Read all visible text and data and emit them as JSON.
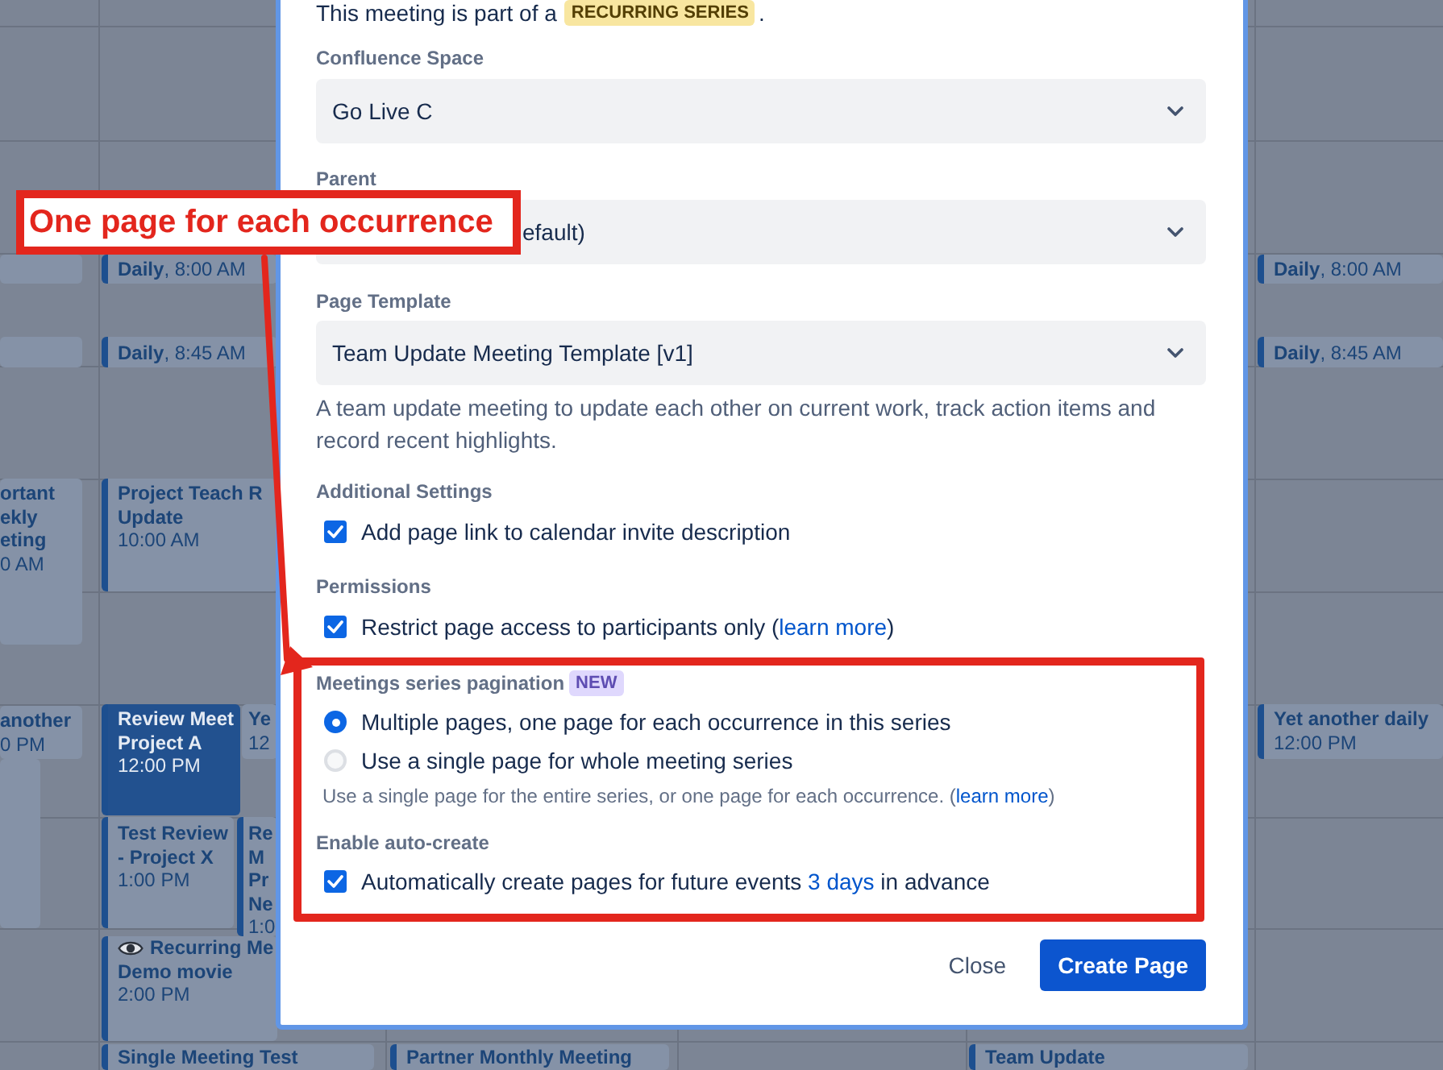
{
  "calendar": {
    "events": [
      {
        "kind": "block",
        "selected": false
      },
      {
        "kind": "block",
        "selected": false
      },
      {
        "kind": "stacked",
        "title": [
          "ortant",
          "ekly",
          "eting"
        ],
        "time": "0 AM",
        "selected": false
      },
      {
        "kind": "stacked",
        "title": [
          "another"
        ],
        "time": "0 PM",
        "selected": false
      },
      {
        "kind": "block",
        "selected": false
      },
      {
        "kind": "single",
        "text": "**Daily**, 8:00 AM",
        "selected": false
      },
      {
        "kind": "single",
        "text": "**Daily**, 8:45 AM",
        "selected": false
      },
      {
        "kind": "stacked",
        "title": [
          "Project Teach R",
          "Update"
        ],
        "time": "10:00 AM",
        "selected": false
      },
      {
        "kind": "stacked",
        "title": [
          "Review Meet",
          "Project A"
        ],
        "time": "12:00 PM",
        "selected": true
      },
      {
        "kind": "stacked",
        "title": [
          "Ye"
        ],
        "time": "12",
        "selected": false
      },
      {
        "kind": "stacked",
        "title": [
          "Test Review",
          "- Project X"
        ],
        "time": "1:00 PM",
        "selected": false
      },
      {
        "kind": "stacked",
        "title": [
          "Re",
          "M",
          "Pr",
          "Ne"
        ],
        "time": "1:0",
        "selected": false
      },
      {
        "kind": "icon",
        "title": [
          "Recurring Me",
          "Demo movie"
        ],
        "time": "2:00 PM",
        "selected": false
      },
      {
        "kind": "stacked",
        "title": [
          "Single Meeting Test"
        ],
        "selected": false
      },
      {
        "kind": "stacked",
        "title": [
          "Partner Monthly Meeting"
        ],
        "selected": false
      },
      {
        "kind": "stacked",
        "title": [
          "Team Update"
        ],
        "selected": false
      },
      {
        "kind": "single",
        "text": "**Daily**, 8:00 AM",
        "selected": false
      },
      {
        "kind": "single",
        "text": "**Daily**, 8:45 AM",
        "selected": false
      },
      {
        "kind": "stacked",
        "title": [
          "Yet another daily"
        ],
        "time": "12:00 PM",
        "selected": false
      }
    ]
  },
  "dialog": {
    "intro": {
      "text": "This meeting is part of a",
      "badge": "RECURRING SERIES",
      "end": "."
    },
    "fields": [
      {
        "label": "Confluence Space",
        "value": "Go Live C"
      },
      {
        "label": "Parent",
        "value": "efault)"
      },
      {
        "label": "Page Template",
        "value": "Team Update Meeting Template [v1]"
      }
    ],
    "template_description": "A team update meeting to update each other on current work, track action items and record recent highlights.",
    "additional_settings": {
      "label": "Additional Settings",
      "option": {
        "text": "Add page link to calendar invite description",
        "checked": true
      }
    },
    "permissions": {
      "label": "Permissions",
      "option": {
        "text": "Restrict page access to participants only (",
        "link": "learn more",
        "text_after": ")",
        "checked": true
      }
    },
    "pagination": {
      "label": "Meetings series pagination",
      "badge": "NEW",
      "options": [
        {
          "label": "Multiple pages, one page for each occurrence in this series",
          "selected": true
        },
        {
          "label": "Use a single page for whole meeting series",
          "selected": false
        }
      ],
      "help": {
        "text": "Use a single page for the entire series, or one page for each occurrence. (",
        "link": "learn more",
        "text_after": ")"
      }
    },
    "auto_create": {
      "label": "Enable auto-create",
      "option": {
        "text": "Automatically create pages for future events ",
        "link": "3 days",
        "text_after": " in advance",
        "checked": true
      }
    },
    "buttons": [
      {
        "label": "Close",
        "kind": "subtle"
      },
      {
        "label": "Create Page",
        "kind": "primary"
      }
    ]
  },
  "annotation": {
    "callout": "One page for each occurrence"
  }
}
